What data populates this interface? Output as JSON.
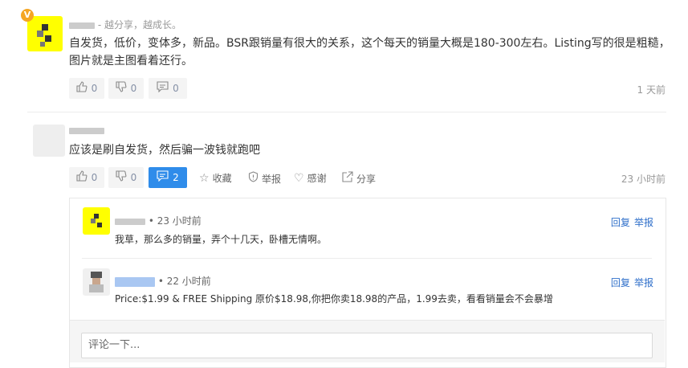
{
  "comments": [
    {
      "badge": "V",
      "author_sep": "- ",
      "author_motto": "越分享，越成长。",
      "text_line1": "自发货，低价，变体多，新品。BSR跟销量有很大的关系，这个每天的销量大概是180-300左右。Listing写的很是粗糙，",
      "text_line2": "图片就是主图看着还行。",
      "upvote_count": "0",
      "downvote_count": "0",
      "reply_count": "0",
      "time": "1 天前",
      "icons": {
        "upvote": "thumbs-up-icon",
        "downvote": "thumbs-down-icon",
        "reply": "comment-icon"
      }
    },
    {
      "text": "应该是刷自发货，然后骗一波钱就跑吧",
      "upvote_count": "0",
      "downvote_count": "0",
      "reply_count": "2",
      "favorite_label": "收藏",
      "report_label": "举报",
      "thanks_label": "感谢",
      "share_label": "分享",
      "time": "23 小时前",
      "icons": {
        "favorite": "star-icon",
        "report": "shield-icon",
        "thanks": "heart-icon",
        "share": "share-icon"
      }
    }
  ],
  "replies": [
    {
      "meta": "• 23 小时前",
      "text": "我草，那么多的销量，弄个十几天，卧槽无情啊。",
      "reply_label": "回复",
      "report_label": "举报"
    },
    {
      "meta": "• 22 小时前",
      "text": "Price:$1.99 & FREE Shipping 原价$18.98,你把你卖18.98的产品，1.99去卖，看看销量会不会暴增",
      "reply_label": "回复",
      "report_label": "举报"
    }
  ],
  "comment_input": {
    "placeholder": "评论一下..."
  },
  "colors": {
    "accent": "#2f8cea",
    "link": "#2f6fca",
    "badge": "#f5a623",
    "avatar_highlight": "#ffff00"
  }
}
